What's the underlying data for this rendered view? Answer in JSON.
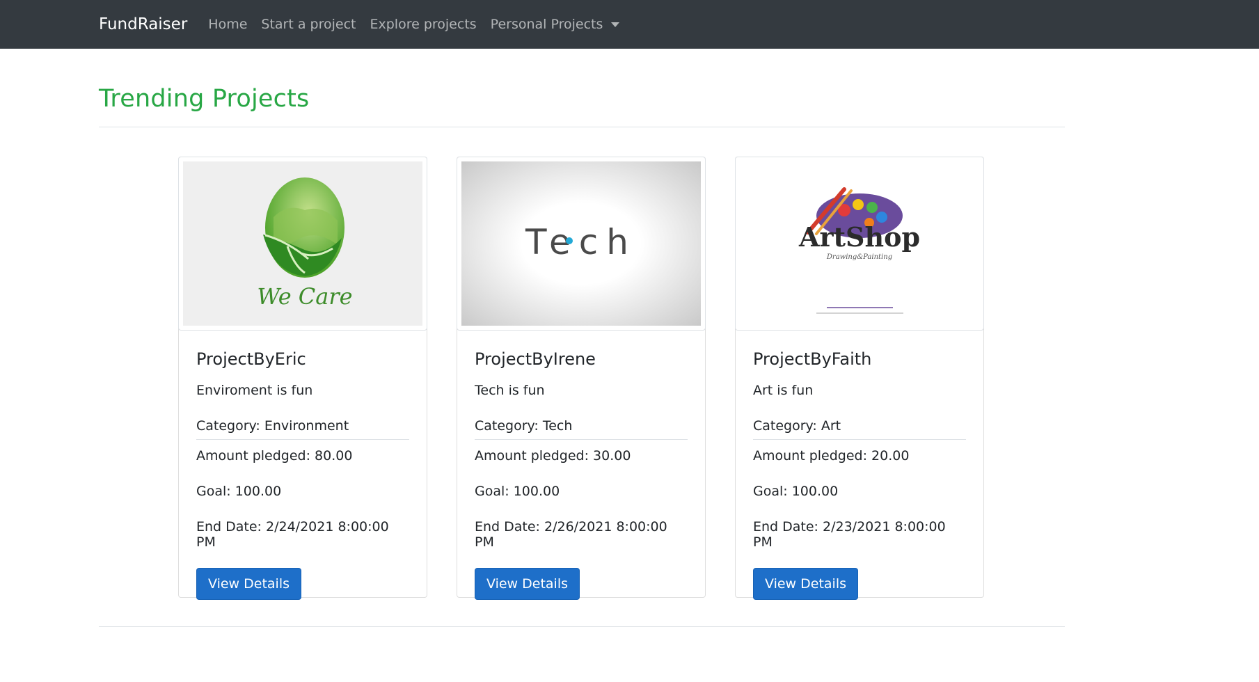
{
  "nav": {
    "brand": "FundRaiser",
    "links": [
      "Home",
      "Start a project",
      "Explore projects",
      "Personal Projects"
    ]
  },
  "page": {
    "title": "Trending Projects"
  },
  "projects": [
    {
      "image_text": "We Care",
      "title": "ProjectByEric",
      "description": "Enviroment is fun",
      "category": "Category: Environment",
      "pledged": "Amount pledged: 80.00",
      "goal": "Goal: 100.00",
      "end_date": "End Date: 2/24/2021 8:00:00 PM",
      "button": "View Details"
    },
    {
      "image_text": "Tech",
      "title": "ProjectByIrene",
      "description": "Tech is fun",
      "category": "Category: Tech",
      "pledged": "Amount pledged: 30.00",
      "goal": "Goal: 100.00",
      "end_date": "End Date: 2/26/2021 8:00:00 PM",
      "button": "View Details"
    },
    {
      "image_text": "ArtShop",
      "image_subtext": "Drawing&Painting",
      "title": "ProjectByFaith",
      "description": "Art is fun",
      "category": "Category: Art",
      "pledged": "Amount pledged: 20.00",
      "goal": "Goal: 100.00",
      "end_date": "End Date: 2/23/2021 8:00:00 PM",
      "button": "View Details"
    }
  ],
  "colors": {
    "navbar": "#343a40",
    "title": "#28a745",
    "button": "#1e6fc9"
  }
}
